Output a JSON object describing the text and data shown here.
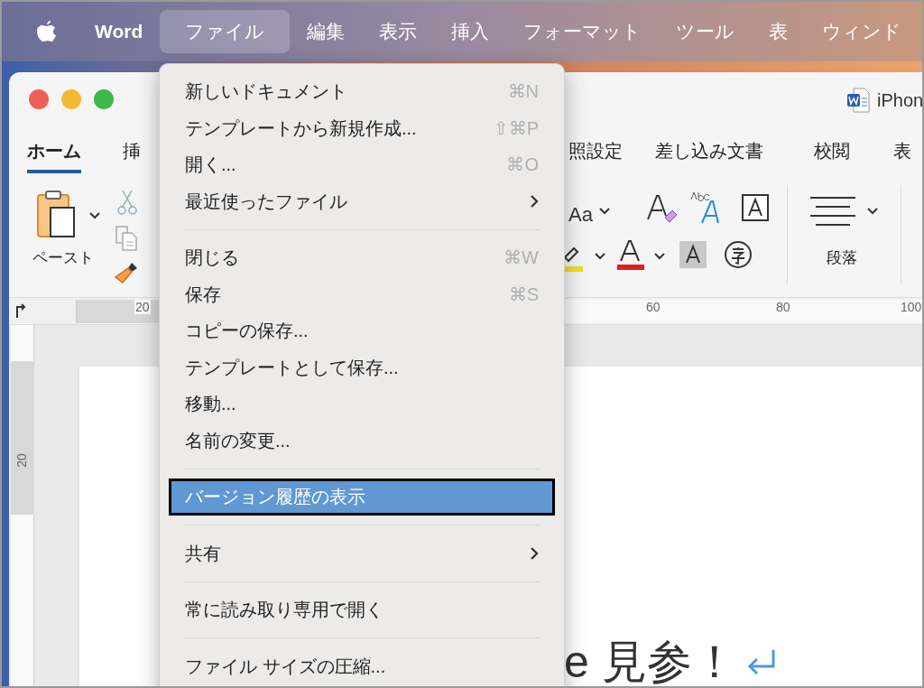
{
  "menubar": {
    "items": [
      {
        "label": "Word",
        "kind": "app",
        "selected": false
      },
      {
        "label": "ファイル",
        "kind": "menu",
        "selected": true
      },
      {
        "label": "編集",
        "kind": "menu",
        "selected": false
      },
      {
        "label": "表示",
        "kind": "menu",
        "selected": false
      },
      {
        "label": "挿入",
        "kind": "menu",
        "selected": false
      },
      {
        "label": "フォーマット",
        "kind": "menu",
        "selected": false
      },
      {
        "label": "ツール",
        "kind": "menu",
        "selected": false
      },
      {
        "label": "表",
        "kind": "menu",
        "selected": false
      },
      {
        "label": "ウィンド",
        "kind": "menu",
        "selected": false
      }
    ]
  },
  "window": {
    "title": "iPhon",
    "tabs": [
      {
        "label": "ホーム",
        "selected": true
      },
      {
        "label": "挿",
        "selected": false
      },
      {
        "label": "照設定",
        "selected": false
      },
      {
        "label": "差し込み文書",
        "selected": false
      },
      {
        "label": "校閲",
        "selected": false
      },
      {
        "label": "表",
        "selected": false
      }
    ],
    "ribbon": {
      "paste_label": "ペースト",
      "paragraph_label": "段落",
      "font_case": "Aa"
    },
    "ruler": {
      "marks": [
        "20",
        "60",
        "80",
        "100"
      ]
    },
    "vertical_ruler": {
      "marks": [
        "20"
      ]
    },
    "document": {
      "text": "e 見参！"
    }
  },
  "menu": {
    "items": [
      {
        "kind": "item",
        "label": "新しいドキュメント",
        "shortcut": "⌘N",
        "selected": false
      },
      {
        "kind": "item",
        "label": "テンプレートから新規作成...",
        "shortcut": "⇧⌘P",
        "selected": false
      },
      {
        "kind": "item",
        "label": "開く...",
        "shortcut": "⌘O",
        "selected": false
      },
      {
        "kind": "item",
        "label": "最近使ったファイル",
        "submenu": true,
        "selected": false
      },
      {
        "kind": "separator"
      },
      {
        "kind": "item",
        "label": "閉じる",
        "shortcut": "⌘W",
        "selected": false
      },
      {
        "kind": "item",
        "label": "保存",
        "shortcut": "⌘S",
        "selected": false
      },
      {
        "kind": "item",
        "label": "コピーの保存...",
        "selected": false
      },
      {
        "kind": "item",
        "label": "テンプレートとして保存...",
        "selected": false
      },
      {
        "kind": "item",
        "label": "移動...",
        "selected": false
      },
      {
        "kind": "item",
        "label": "名前の変更...",
        "selected": false
      },
      {
        "kind": "separator"
      },
      {
        "kind": "item",
        "label": "バージョン履歴の表示",
        "selected": true
      },
      {
        "kind": "separator"
      },
      {
        "kind": "item",
        "label": "共有",
        "submenu": true,
        "selected": false
      },
      {
        "kind": "separator"
      },
      {
        "kind": "item",
        "label": "常に読み取り専用で開く",
        "selected": false
      },
      {
        "kind": "separator"
      },
      {
        "kind": "item",
        "label": "ファイル サイズの圧縮...",
        "selected": false
      }
    ]
  }
}
